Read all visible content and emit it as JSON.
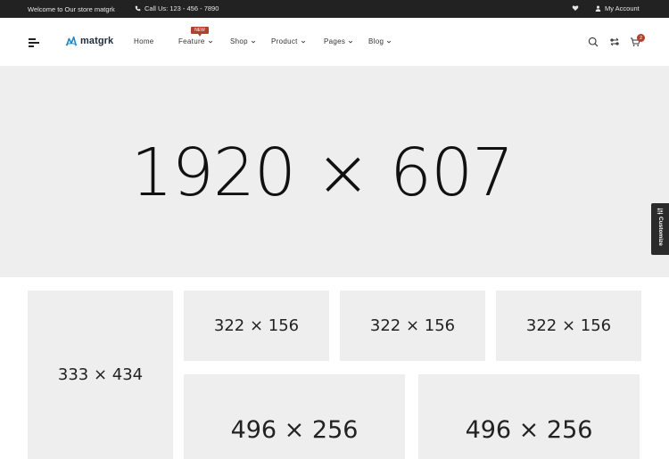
{
  "topbar": {
    "welcome": "Welcome to Our store matgrk",
    "phone": "Call Us: 123 - 456 - 7890",
    "account": "My Account",
    "icons": [
      "phone-icon",
      "heart-icon",
      "user-icon"
    ]
  },
  "header": {
    "logo": "matgrk",
    "nav": [
      {
        "label": "Home",
        "dropdown": false
      },
      {
        "label": "Feature",
        "dropdown": true,
        "badge": "NEW"
      },
      {
        "label": "Shop",
        "dropdown": true
      },
      {
        "label": "Product",
        "dropdown": true
      },
      {
        "label": "Pages",
        "dropdown": true
      },
      {
        "label": "Blog",
        "dropdown": true
      }
    ],
    "cart_count": "2",
    "icons": [
      "menu-icon",
      "search-icon",
      "compare-icon",
      "cart-icon",
      "chevron-down-icon"
    ]
  },
  "hero": {
    "placeholder": "1920 × 607"
  },
  "customize": {
    "label": "Customize"
  },
  "banners": [
    {
      "placeholder": "333 × 434"
    },
    {
      "placeholder": "322 × 156"
    },
    {
      "placeholder": "322 × 156"
    },
    {
      "placeholder": "322 × 156"
    },
    {
      "placeholder": "496 × 256"
    },
    {
      "placeholder": "496 × 256"
    }
  ],
  "colors": {
    "topbar_bg": "#222222",
    "accent": "#b04030",
    "placeholder_bg": "#eeeeee",
    "text_dark": "#222222"
  }
}
